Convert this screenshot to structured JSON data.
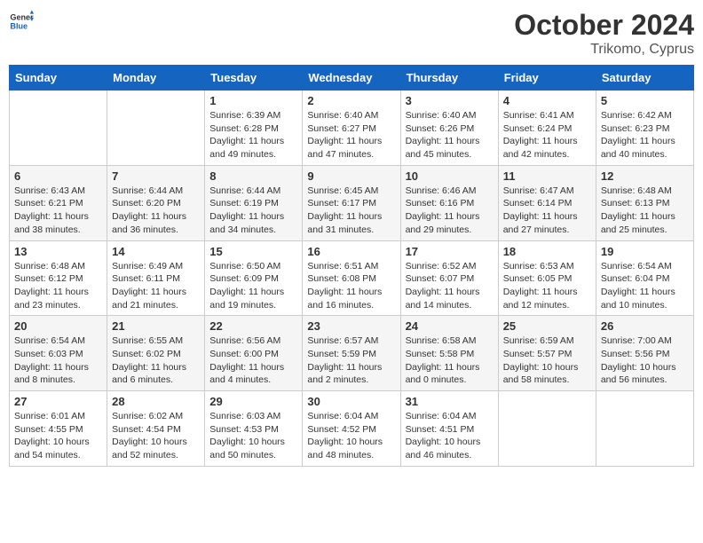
{
  "header": {
    "logo_general": "General",
    "logo_blue": "Blue",
    "month": "October 2024",
    "location": "Trikomo, Cyprus"
  },
  "days_of_week": [
    "Sunday",
    "Monday",
    "Tuesday",
    "Wednesday",
    "Thursday",
    "Friday",
    "Saturday"
  ],
  "weeks": [
    [
      {
        "day": "",
        "info": ""
      },
      {
        "day": "",
        "info": ""
      },
      {
        "day": "1",
        "info": "Sunrise: 6:39 AM\nSunset: 6:28 PM\nDaylight: 11 hours and 49 minutes."
      },
      {
        "day": "2",
        "info": "Sunrise: 6:40 AM\nSunset: 6:27 PM\nDaylight: 11 hours and 47 minutes."
      },
      {
        "day": "3",
        "info": "Sunrise: 6:40 AM\nSunset: 6:26 PM\nDaylight: 11 hours and 45 minutes."
      },
      {
        "day": "4",
        "info": "Sunrise: 6:41 AM\nSunset: 6:24 PM\nDaylight: 11 hours and 42 minutes."
      },
      {
        "day": "5",
        "info": "Sunrise: 6:42 AM\nSunset: 6:23 PM\nDaylight: 11 hours and 40 minutes."
      }
    ],
    [
      {
        "day": "6",
        "info": "Sunrise: 6:43 AM\nSunset: 6:21 PM\nDaylight: 11 hours and 38 minutes."
      },
      {
        "day": "7",
        "info": "Sunrise: 6:44 AM\nSunset: 6:20 PM\nDaylight: 11 hours and 36 minutes."
      },
      {
        "day": "8",
        "info": "Sunrise: 6:44 AM\nSunset: 6:19 PM\nDaylight: 11 hours and 34 minutes."
      },
      {
        "day": "9",
        "info": "Sunrise: 6:45 AM\nSunset: 6:17 PM\nDaylight: 11 hours and 31 minutes."
      },
      {
        "day": "10",
        "info": "Sunrise: 6:46 AM\nSunset: 6:16 PM\nDaylight: 11 hours and 29 minutes."
      },
      {
        "day": "11",
        "info": "Sunrise: 6:47 AM\nSunset: 6:14 PM\nDaylight: 11 hours and 27 minutes."
      },
      {
        "day": "12",
        "info": "Sunrise: 6:48 AM\nSunset: 6:13 PM\nDaylight: 11 hours and 25 minutes."
      }
    ],
    [
      {
        "day": "13",
        "info": "Sunrise: 6:48 AM\nSunset: 6:12 PM\nDaylight: 11 hours and 23 minutes."
      },
      {
        "day": "14",
        "info": "Sunrise: 6:49 AM\nSunset: 6:11 PM\nDaylight: 11 hours and 21 minutes."
      },
      {
        "day": "15",
        "info": "Sunrise: 6:50 AM\nSunset: 6:09 PM\nDaylight: 11 hours and 19 minutes."
      },
      {
        "day": "16",
        "info": "Sunrise: 6:51 AM\nSunset: 6:08 PM\nDaylight: 11 hours and 16 minutes."
      },
      {
        "day": "17",
        "info": "Sunrise: 6:52 AM\nSunset: 6:07 PM\nDaylight: 11 hours and 14 minutes."
      },
      {
        "day": "18",
        "info": "Sunrise: 6:53 AM\nSunset: 6:05 PM\nDaylight: 11 hours and 12 minutes."
      },
      {
        "day": "19",
        "info": "Sunrise: 6:54 AM\nSunset: 6:04 PM\nDaylight: 11 hours and 10 minutes."
      }
    ],
    [
      {
        "day": "20",
        "info": "Sunrise: 6:54 AM\nSunset: 6:03 PM\nDaylight: 11 hours and 8 minutes."
      },
      {
        "day": "21",
        "info": "Sunrise: 6:55 AM\nSunset: 6:02 PM\nDaylight: 11 hours and 6 minutes."
      },
      {
        "day": "22",
        "info": "Sunrise: 6:56 AM\nSunset: 6:00 PM\nDaylight: 11 hours and 4 minutes."
      },
      {
        "day": "23",
        "info": "Sunrise: 6:57 AM\nSunset: 5:59 PM\nDaylight: 11 hours and 2 minutes."
      },
      {
        "day": "24",
        "info": "Sunrise: 6:58 AM\nSunset: 5:58 PM\nDaylight: 11 hours and 0 minutes."
      },
      {
        "day": "25",
        "info": "Sunrise: 6:59 AM\nSunset: 5:57 PM\nDaylight: 10 hours and 58 minutes."
      },
      {
        "day": "26",
        "info": "Sunrise: 7:00 AM\nSunset: 5:56 PM\nDaylight: 10 hours and 56 minutes."
      }
    ],
    [
      {
        "day": "27",
        "info": "Sunrise: 6:01 AM\nSunset: 4:55 PM\nDaylight: 10 hours and 54 minutes."
      },
      {
        "day": "28",
        "info": "Sunrise: 6:02 AM\nSunset: 4:54 PM\nDaylight: 10 hours and 52 minutes."
      },
      {
        "day": "29",
        "info": "Sunrise: 6:03 AM\nSunset: 4:53 PM\nDaylight: 10 hours and 50 minutes."
      },
      {
        "day": "30",
        "info": "Sunrise: 6:04 AM\nSunset: 4:52 PM\nDaylight: 10 hours and 48 minutes."
      },
      {
        "day": "31",
        "info": "Sunrise: 6:04 AM\nSunset: 4:51 PM\nDaylight: 10 hours and 46 minutes."
      },
      {
        "day": "",
        "info": ""
      },
      {
        "day": "",
        "info": ""
      }
    ]
  ]
}
